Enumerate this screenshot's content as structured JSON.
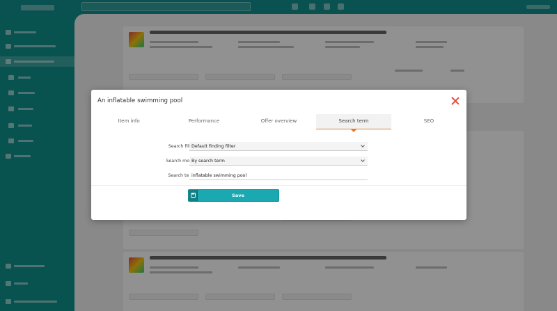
{
  "modal": {
    "title": "An inflatable swimming pool",
    "tabs": [
      {
        "label": "Item info"
      },
      {
        "label": "Performance"
      },
      {
        "label": "Offer overview"
      },
      {
        "label": "Search term",
        "active": true
      },
      {
        "label": "SEO"
      }
    ],
    "fields": {
      "search_filter": {
        "label": "Search filter",
        "value": "Default finding filter"
      },
      "search_mode": {
        "label": "Search mode",
        "value": "By search term"
      },
      "search_term": {
        "label": "Search term",
        "value": "inflatable swimming pool"
      }
    },
    "save_label": "Save"
  },
  "colors": {
    "accent_teal": "#1aa9b1",
    "tab_underline": "#e87a2a",
    "close": "#e74c3c",
    "sidebar": "#0f8f8a"
  },
  "icons": {
    "close": "close-icon",
    "save": "floppy-disk-icon",
    "dropdown": "chevron-down-icon"
  }
}
